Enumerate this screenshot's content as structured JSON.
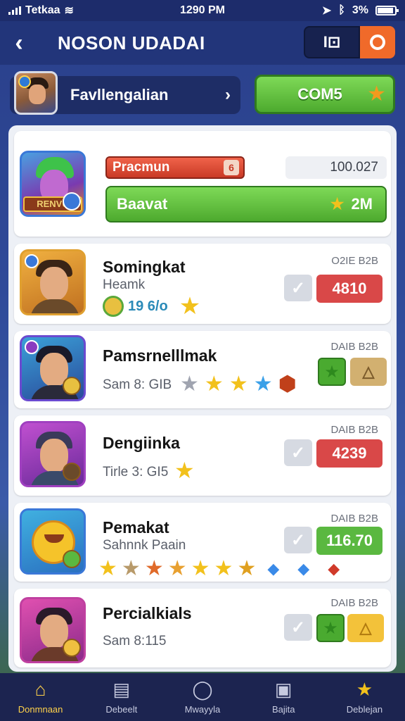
{
  "status_bar": {
    "carrier": "Tetkaa",
    "time": "1290 PM",
    "battery": "3%"
  },
  "header": {
    "title": "NOSON UDADAI",
    "action_label": "I⊡"
  },
  "profile": {
    "name": "Favllengalian",
    "coins_label": "COM5"
  },
  "featured": {
    "bar_label": "Pracmun",
    "bar_end": "6",
    "bar_value": "100.027",
    "claim_label": "Baavat",
    "claim_amount": "2M",
    "avatar_text": "RENVU"
  },
  "entries": [
    {
      "name": "Somingkat",
      "sub": "Heamk",
      "coins": "19 6/o",
      "date": "O2IE B2B",
      "score": "4810",
      "score_kind": "red"
    },
    {
      "name": "Pamsrnelllmak",
      "sub": "Sam 8: GIB",
      "date": "DAIB B2B"
    },
    {
      "name": "Dengiinka",
      "sub": "Tirle 3: GI5",
      "date": "DAIB B2B",
      "score": "4239",
      "score_kind": "red"
    },
    {
      "name": "Pemakat",
      "sub": "Sahnnk Paain",
      "date": "DAIB B2B",
      "score": "116.70",
      "score_kind": "green"
    },
    {
      "name": "Percialkials",
      "sub": "Sam 8:115",
      "date": "DAIB B2B"
    }
  ],
  "tabs": [
    {
      "label": "Donmnaan",
      "icon": "home-icon"
    },
    {
      "label": "Debeelt",
      "icon": "calendar-icon"
    },
    {
      "label": "Mwayyla",
      "icon": "search-icon"
    },
    {
      "label": "Bajita",
      "icon": "shop-icon"
    },
    {
      "label": "Deblejan",
      "icon": "star-icon"
    }
  ]
}
